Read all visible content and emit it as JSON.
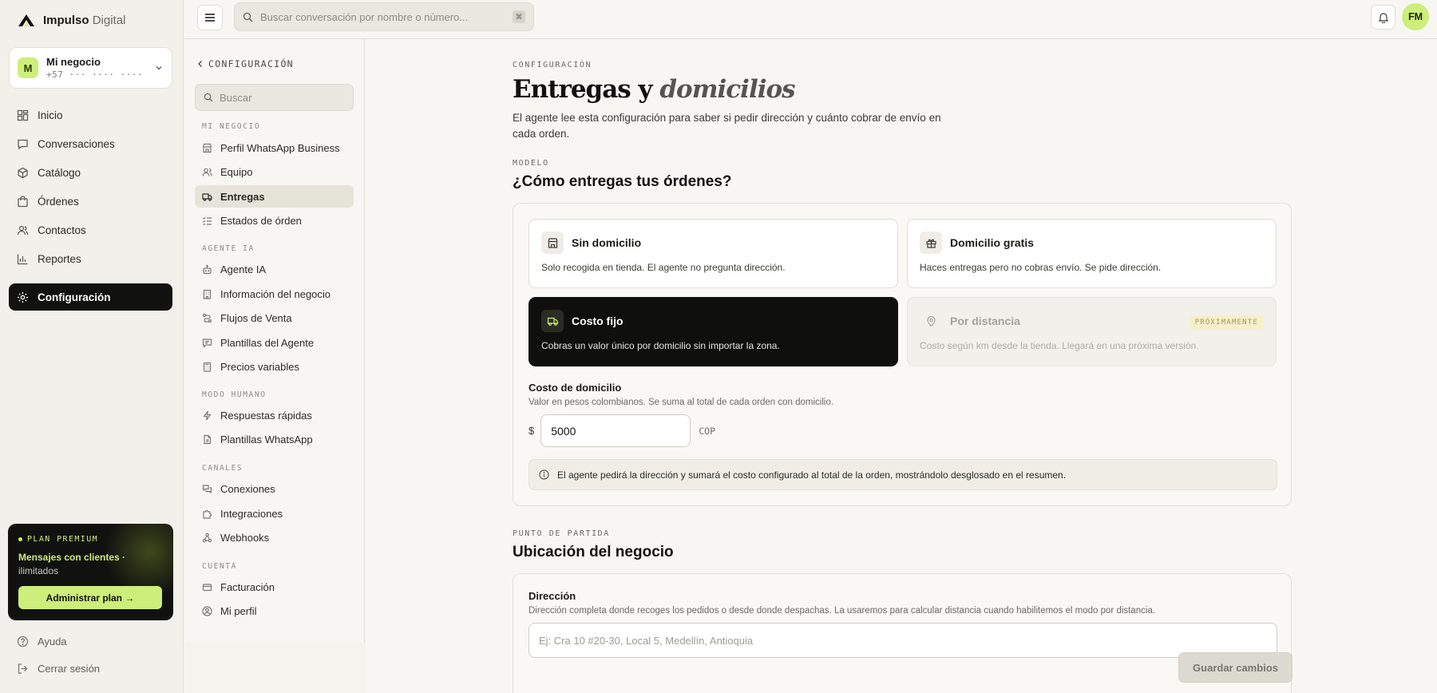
{
  "brand": {
    "name_bold": "Impulso",
    "name_light": "Digital"
  },
  "business": {
    "initial": "M",
    "name": "Mi negocio",
    "phone": "+57 ··· ···· ····"
  },
  "nav": [
    {
      "label": "Inicio",
      "icon": "grid-icon"
    },
    {
      "label": "Conversaciones",
      "icon": "chat-icon"
    },
    {
      "label": "Catálogo",
      "icon": "box-icon"
    },
    {
      "label": "Órdenes",
      "icon": "bag-icon"
    },
    {
      "label": "Contactos",
      "icon": "users-icon"
    },
    {
      "label": "Reportes",
      "icon": "chart-icon"
    },
    {
      "label": "Configuración",
      "icon": "gear-icon",
      "active": true
    }
  ],
  "plan": {
    "tag": "PLAN PREMIUM",
    "title": "Mensajes con clientes ·",
    "subtitle": "ilimitados",
    "button": "Administrar plan →"
  },
  "footer_links": [
    {
      "label": "Ayuda",
      "icon": "help-icon"
    },
    {
      "label": "Cerrar sesión",
      "icon": "logout-icon"
    }
  ],
  "topbar": {
    "search_placeholder": "Buscar conversación por nombre o número...",
    "kbd": "⌘",
    "user_initials": "FM"
  },
  "settings_nav": {
    "back_label": "CONFIGURACIÓN",
    "search_placeholder": "Buscar",
    "groups": [
      {
        "label": "MI NEGOCIO",
        "items": [
          "Perfil WhatsApp Business",
          "Equipo",
          "Entregas",
          "Estados de órden"
        ]
      },
      {
        "label": "AGENTE IA",
        "items": [
          "Agente IA",
          "Información del negocio",
          "Flujos de Venta",
          "Plantillas del Agente",
          "Precios variables"
        ]
      },
      {
        "label": "MODO HUMANO",
        "items": [
          "Respuestas rápidas",
          "Plantillas WhatsApp"
        ]
      },
      {
        "label": "CANALES",
        "items": [
          "Conexiones",
          "Integraciones",
          "Webhooks"
        ]
      },
      {
        "label": "CUENTA",
        "items": [
          "Facturación",
          "Mi perfil"
        ]
      }
    ],
    "active_item": "Entregas"
  },
  "page": {
    "eyebrow": "CONFIGURACIÓN",
    "title_plain": "Entregas y",
    "title_italic": "domicilios",
    "description": "El agente lee esta configuración para saber si pedir dirección y cuánto cobrar de envío en cada orden."
  },
  "model_section": {
    "eyebrow": "MODELO",
    "title": "¿Cómo entregas tus órdenes?",
    "options": [
      {
        "title": "Sin domicilio",
        "desc": "Solo recogida en tienda. El agente no pregunta dirección.",
        "icon": "store-icon"
      },
      {
        "title": "Domicilio gratis",
        "desc": "Haces entregas pero no cobras envío. Se pide dirección.",
        "icon": "gift-icon"
      },
      {
        "title": "Costo fijo",
        "desc": "Cobras un valor único por domicilio sin importar la zona.",
        "icon": "truck-icon",
        "selected": true
      },
      {
        "title": "Por distancia",
        "desc": "Costo según km desde la tienda. Llegará en una próxima versión.",
        "icon": "pin-icon",
        "disabled": true,
        "badge": "PRÓXIMAMENTE"
      }
    ],
    "cost": {
      "label": "Costo de domicilio",
      "hint": "Valor en pesos colombianos. Se suma al total de cada orden con domicilio.",
      "currency_symbol": "$",
      "value": "5000",
      "currency_code": "COP"
    },
    "info": "El agente pedirá la dirección y sumará el costo configurado al total de la orden, mostrándolo desglosado en el resumen."
  },
  "location_section": {
    "eyebrow": "PUNTO DE PARTIDA",
    "title": "Ubicación del negocio",
    "address_label": "Dirección",
    "address_hint": "Dirección completa donde recoges los pedidos o desde donde despachas. La usaremos para calcular distancia cuando habilitemos el modo por distancia.",
    "address_placeholder": "Ej: Cra 10 #20-30, Local 5, Medellín, Antioquia"
  },
  "save_button": "Guardar cambios"
}
